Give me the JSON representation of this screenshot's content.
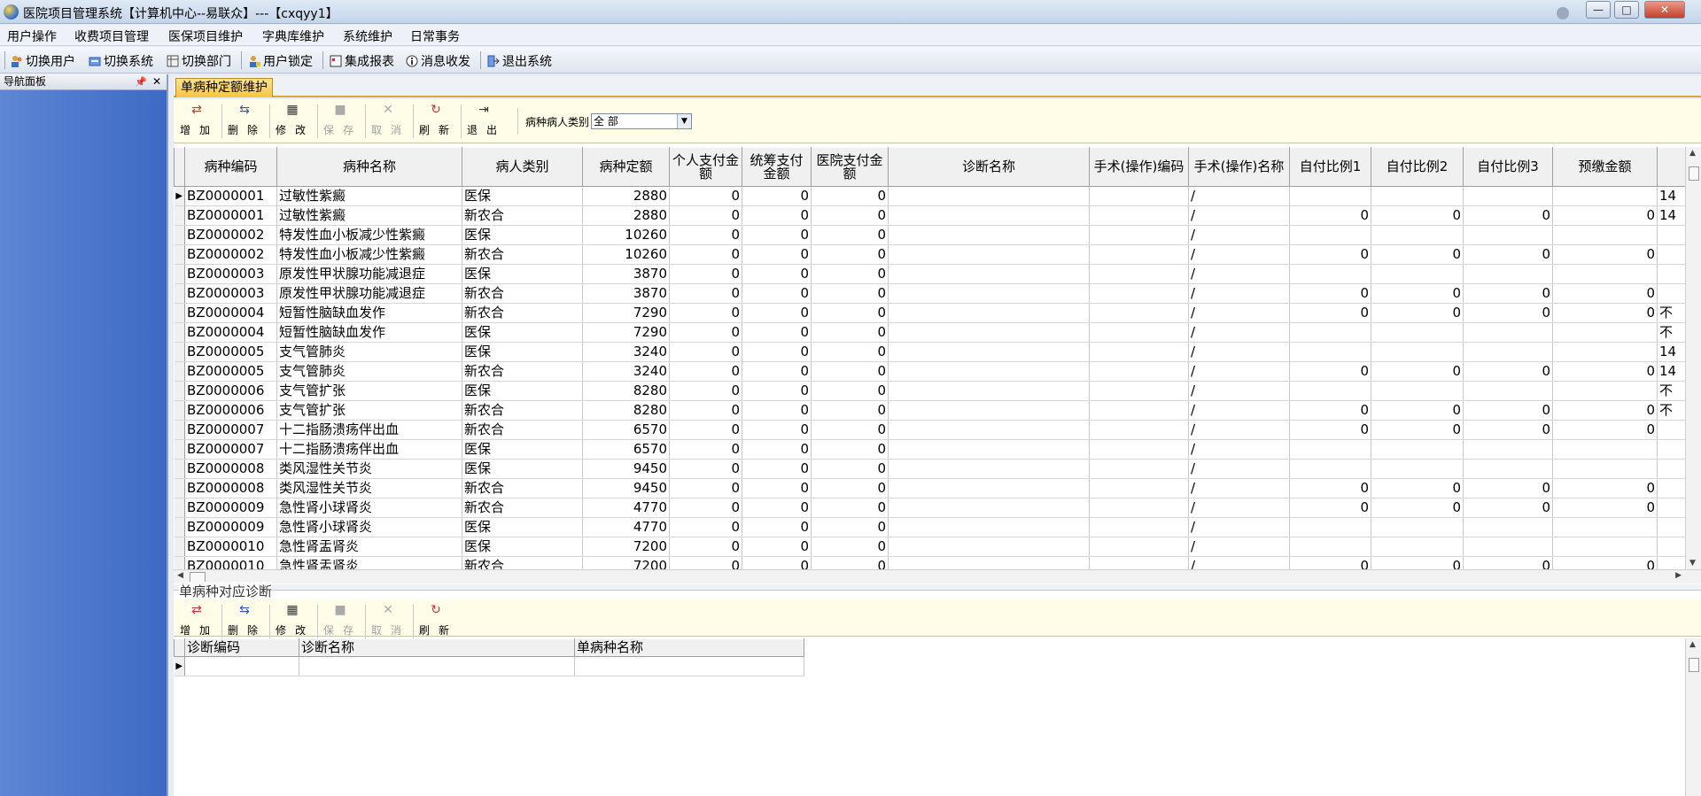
{
  "window": {
    "title": "医院项目管理系统【计算机中心--易联众】---【cxqyy1】",
    "minimize": "—",
    "maximize": "□",
    "close": "✕"
  },
  "menu": [
    "用户操作",
    "收费项目管理",
    "医保项目维护",
    "字典库维护",
    "系统维护",
    "日常事务"
  ],
  "toolbar": [
    "切换用户",
    "切换系统",
    "切换部门",
    "用户锁定",
    "集成报表",
    "消息收发",
    "退出系统"
  ],
  "nav": {
    "title": "导航面板",
    "pin": "📌",
    "close": "✕"
  },
  "tab": {
    "label": "单病种定额维护"
  },
  "actions": [
    {
      "label": "增加",
      "icon": "⇄",
      "disabled": false
    },
    {
      "label": "删除",
      "icon": "⇆",
      "disabled": false
    },
    {
      "label": "修改",
      "icon": "▦",
      "disabled": false
    },
    {
      "label": "保存",
      "icon": "■",
      "disabled": true
    },
    {
      "label": "取消",
      "icon": "✕",
      "disabled": true
    },
    {
      "label": "刷新",
      "icon": "↻",
      "disabled": false
    },
    {
      "label": "退出",
      "icon": "⇥",
      "disabled": false
    }
  ],
  "filter": {
    "label": "病种病人类别",
    "value": "全 部"
  },
  "main_grid": {
    "columns": [
      "病种编码",
      "病种名称",
      "病人类别",
      "病种定额",
      "个人支付金额",
      "统筹支付金额",
      "医院支付金额",
      "诊断名称",
      "手术(操作)编码",
      "手术(操作)名称",
      "自付比例1",
      "自付比例2",
      "自付比例3",
      "预缴金额"
    ],
    "rows": [
      [
        "BZ0000001",
        "过敏性紫癜",
        "医保",
        "2880",
        "0",
        "0",
        "0",
        "",
        "",
        "/",
        "",
        "",
        "",
        "",
        "14"
      ],
      [
        "BZ0000001",
        "过敏性紫癜",
        "新农合",
        "2880",
        "0",
        "0",
        "0",
        "",
        "",
        "/",
        "0",
        "0",
        "0",
        "0",
        "14"
      ],
      [
        "BZ0000002",
        "特发性血小板减少性紫癜",
        "医保",
        "10260",
        "0",
        "0",
        "0",
        "",
        "",
        "/",
        "",
        "",
        "",
        "",
        ""
      ],
      [
        "BZ0000002",
        "特发性血小板减少性紫癜",
        "新农合",
        "10260",
        "0",
        "0",
        "0",
        "",
        "",
        "/",
        "0",
        "0",
        "0",
        "0",
        ""
      ],
      [
        "BZ0000003",
        "原发性甲状腺功能减退症",
        "医保",
        "3870",
        "0",
        "0",
        "0",
        "",
        "",
        "/",
        "",
        "",
        "",
        "",
        ""
      ],
      [
        "BZ0000003",
        "原发性甲状腺功能减退症",
        "新农合",
        "3870",
        "0",
        "0",
        "0",
        "",
        "",
        "/",
        "0",
        "0",
        "0",
        "0",
        ""
      ],
      [
        "BZ0000004",
        "短暂性脑缺血发作",
        "新农合",
        "7290",
        "0",
        "0",
        "0",
        "",
        "",
        "/",
        "0",
        "0",
        "0",
        "0",
        "不"
      ],
      [
        "BZ0000004",
        "短暂性脑缺血发作",
        "医保",
        "7290",
        "0",
        "0",
        "0",
        "",
        "",
        "/",
        "",
        "",
        "",
        "",
        "不"
      ],
      [
        "BZ0000005",
        "支气管肺炎",
        "医保",
        "3240",
        "0",
        "0",
        "0",
        "",
        "",
        "/",
        "",
        "",
        "",
        "",
        "14"
      ],
      [
        "BZ0000005",
        "支气管肺炎",
        "新农合",
        "3240",
        "0",
        "0",
        "0",
        "",
        "",
        "/",
        "0",
        "0",
        "0",
        "0",
        "14"
      ],
      [
        "BZ0000006",
        "支气管扩张",
        "医保",
        "8280",
        "0",
        "0",
        "0",
        "",
        "",
        "/",
        "",
        "",
        "",
        "",
        "不"
      ],
      [
        "BZ0000006",
        "支气管扩张",
        "新农合",
        "8280",
        "0",
        "0",
        "0",
        "",
        "",
        "/",
        "0",
        "0",
        "0",
        "0",
        "不"
      ],
      [
        "BZ0000007",
        "十二指肠溃疡伴出血",
        "新农合",
        "6570",
        "0",
        "0",
        "0",
        "",
        "",
        "/",
        "0",
        "0",
        "0",
        "0",
        ""
      ],
      [
        "BZ0000007",
        "十二指肠溃疡伴出血",
        "医保",
        "6570",
        "0",
        "0",
        "0",
        "",
        "",
        "/",
        "",
        "",
        "",
        "",
        ""
      ],
      [
        "BZ0000008",
        "类风湿性关节炎",
        "医保",
        "9450",
        "0",
        "0",
        "0",
        "",
        "",
        "/",
        "",
        "",
        "",
        "",
        ""
      ],
      [
        "BZ0000008",
        "类风湿性关节炎",
        "新农合",
        "9450",
        "0",
        "0",
        "0",
        "",
        "",
        "/",
        "0",
        "0",
        "0",
        "0",
        ""
      ],
      [
        "BZ0000009",
        "急性肾小球肾炎",
        "新农合",
        "4770",
        "0",
        "0",
        "0",
        "",
        "",
        "/",
        "0",
        "0",
        "0",
        "0",
        ""
      ],
      [
        "BZ0000009",
        "急性肾小球肾炎",
        "医保",
        "4770",
        "0",
        "0",
        "0",
        "",
        "",
        "/",
        "",
        "",
        "",
        "",
        ""
      ],
      [
        "BZ0000010",
        "急性肾盂肾炎",
        "医保",
        "7200",
        "0",
        "0",
        "0",
        "",
        "",
        "/",
        "",
        "",
        "",
        "",
        ""
      ],
      [
        "BZ0000010",
        "急性肾盂肾炎",
        "新农合",
        "7200",
        "0",
        "0",
        "0",
        "",
        "",
        "/",
        "0",
        "0",
        "0",
        "0",
        ""
      ]
    ]
  },
  "sub_section": {
    "title": "单病种对应诊断",
    "actions": [
      {
        "label": "增加",
        "icon": "⇄",
        "disabled": false
      },
      {
        "label": "删除",
        "icon": "⇆",
        "disabled": false
      },
      {
        "label": "修改",
        "icon": "▦",
        "disabled": false
      },
      {
        "label": "保存",
        "icon": "■",
        "disabled": true
      },
      {
        "label": "取消",
        "icon": "✕",
        "disabled": true
      },
      {
        "label": "刷新",
        "icon": "↻",
        "disabled": false
      }
    ],
    "columns": [
      "诊断编码",
      "诊断名称",
      "单病种名称"
    ]
  },
  "colors": {
    "accent_tab": "#f5c441",
    "nav_bg": "#4a76cc",
    "actionbar_bg": "#fffde8"
  }
}
